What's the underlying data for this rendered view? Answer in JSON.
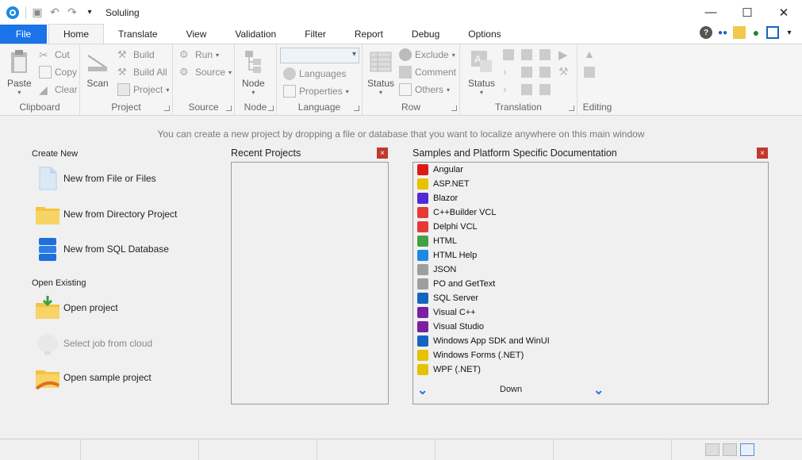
{
  "window": {
    "title": "Soluling"
  },
  "tabs": [
    "Home",
    "Translate",
    "View",
    "Validation",
    "Filter",
    "Report",
    "Debug",
    "Options"
  ],
  "file_tab": "File",
  "ribbon": {
    "clipboard": {
      "paste": "Paste",
      "cut": "Cut",
      "copy": "Copy",
      "clear": "Clear",
      "label": "Clipboard"
    },
    "project": {
      "scan": "Scan",
      "build": "Build",
      "build_all": "Build All",
      "project": "Project",
      "label": "Project"
    },
    "source": {
      "run": "Run",
      "source": "Source",
      "label": "Source"
    },
    "node": {
      "node": "Node",
      "label": "Node"
    },
    "language": {
      "languages": "Languages",
      "properties": "Properties",
      "label": "Language"
    },
    "row": {
      "status": "Status",
      "exclude": "Exclude",
      "comment": "Comment",
      "others": "Others",
      "label": "Row"
    },
    "translation": {
      "status": "Status",
      "label": "Translation"
    },
    "editing": {
      "label": "Editing"
    }
  },
  "hint": "You can create a new project by dropping a file or database that you want to localize anywhere on this main window",
  "create_new": {
    "title": "Create New",
    "items": [
      "New from File or Files",
      "New from Directory Project",
      "New from SQL Database"
    ]
  },
  "open_existing": {
    "title": "Open Existing",
    "items": [
      "Open project",
      "Select job from cloud",
      "Open sample project"
    ]
  },
  "recent": {
    "title": "Recent Projects",
    "close": "×"
  },
  "samples": {
    "title": "Samples and Platform Specific Documentation",
    "close": "×",
    "items": [
      "Angular",
      "ASP.NET",
      "Blazor",
      "C++Builder VCL",
      "Delphi VCL",
      "HTML",
      "HTML Help",
      "JSON",
      "PO and GetText",
      "SQL Server",
      "Visual C++",
      "Visual Studio",
      "Windows App SDK and WinUI",
      "Windows Forms (.NET)",
      "WPF (.NET)"
    ],
    "item_colors": [
      "#dd1b16",
      "#e6c200",
      "#512bd4",
      "#e53935",
      "#e53935",
      "#43a047",
      "#1e88e5",
      "#9e9e9e",
      "#9e9e9e",
      "#1565c0",
      "#7b1fa2",
      "#7b1fa2",
      "#1565c0",
      "#e6c200",
      "#e6c200"
    ],
    "down": "Down"
  }
}
